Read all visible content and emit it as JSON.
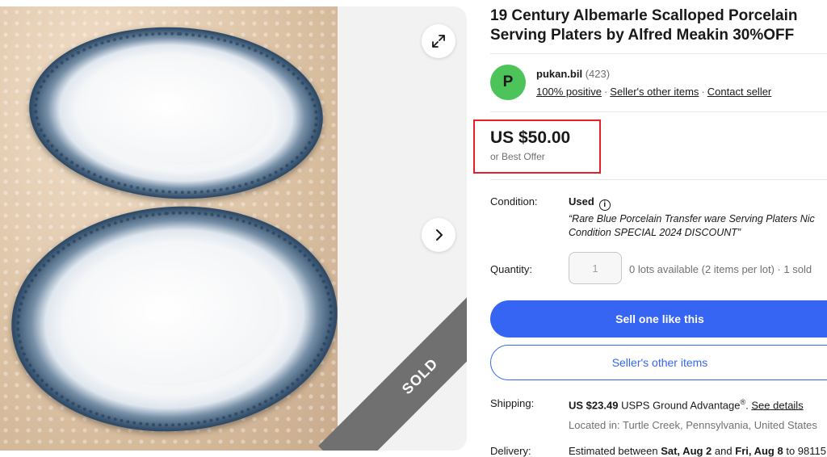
{
  "listing": {
    "title_line1": "19 Century Albemarle Scalloped Porcelain",
    "title_line2": "Serving Platers by Alfred Meakin 30%OFF"
  },
  "gallery": {
    "sold_label": "SOLD",
    "expand_icon": "expand-icon",
    "next_icon": "chevron-right-icon"
  },
  "seller": {
    "avatar_letter": "P",
    "avatar_color": "#4cc459",
    "name": "pukan.bil",
    "feedback_count": "(423)",
    "positive": "100% positive",
    "other_items": "Seller's other items",
    "contact": "Contact seller"
  },
  "price": {
    "amount": "US $50.00",
    "best_offer": "or Best Offer",
    "highlight_color": "#e6202b"
  },
  "condition": {
    "label": "Condition:",
    "value": "Used",
    "desc_line1": "“Rare Blue Porcelain Transfer ware Serving Platers Nic",
    "desc_line2": "Condition SPECIAL 2024 DISCOUNT”"
  },
  "quantity": {
    "label": "Quantity:",
    "value": "1",
    "availability": "0 lots available (2 items per lot) · 1 sold"
  },
  "buttons": {
    "sell_one": "Sell one like this",
    "sellers_other_items": "Seller's other items",
    "primary_color": "#3665f3"
  },
  "shipping": {
    "label": "Shipping:",
    "cost": "US $23.49",
    "service": "USPS Ground Advantage",
    "trademark": "®",
    "see_details": "See details",
    "located_in": "Located in: Turtle Creek, Pennsylvania, United States"
  },
  "delivery": {
    "label": "Delivery:",
    "estimated": "Estimated between",
    "start": "Sat, Aug 2",
    "and": "and",
    "end": "Fri, Aug 8",
    "to": "to 98115"
  }
}
